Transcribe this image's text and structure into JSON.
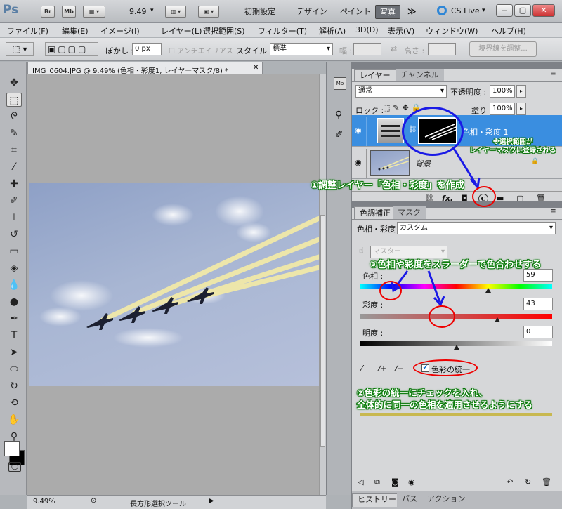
{
  "app": {
    "logo": "Ps",
    "bridge": "Br",
    "minibridge": "Mb",
    "zoom": "9.49",
    "workspaces": [
      "初期設定",
      "デザイン",
      "ペイント",
      "写真"
    ],
    "more": "≫",
    "cslive": "CS Live"
  },
  "menu": [
    "ファイル(F)",
    "編集(E)",
    "イメージ(I)",
    "レイヤー(L)",
    "選択範囲(S)",
    "フィルター(T)",
    "解析(A)",
    "3D(D)",
    "表示(V)",
    "ウィンドウ(W)",
    "ヘルプ(H)"
  ],
  "options": {
    "feather_label": "ぼかし :",
    "feather_value": "0 px",
    "antialias": "アンチエイリアス",
    "style_label": "スタイル :",
    "style_value": "標準",
    "width_label": "幅 :",
    "height_label": "高さ :",
    "refine_edge": "境界線を調整..."
  },
  "document": {
    "tab_title": "IMG_0604.JPG @ 9.49% (色相・彩度1, レイヤーマスク/8) *",
    "status_zoom": "9.49%",
    "status_tool": "長方形選択ツール"
  },
  "layers_panel": {
    "tabs": [
      "レイヤー",
      "チャンネル"
    ],
    "blend_mode": "通常",
    "opacity_label": "不透明度 :",
    "opacity": "100%",
    "lock_label": "ロック :",
    "fill_label": "塗り :",
    "fill": "100%",
    "layers": [
      {
        "name": "色相・彩度 1"
      },
      {
        "name": "背景"
      }
    ]
  },
  "adjust_panel": {
    "tabs": [
      "色調補正",
      "マスク"
    ],
    "title": "色相・彩度",
    "preset": "カスタム",
    "master": "マスター",
    "hue_label": "色相 :",
    "hue_value": "59",
    "saturation_label": "彩度 :",
    "saturation_value": "43",
    "lightness_label": "明度 :",
    "lightness_value": "0",
    "colorize_label": "色彩の統一",
    "colorize_checked": true,
    "hue_level": 0.665,
    "saturation_level": 0.715,
    "lightness_level": 0.5
  },
  "bottom_tabs": [
    "ヒストリー",
    "パス",
    "アクション"
  ],
  "annotations": {
    "note_mask": "※選択範囲が\nレイヤーマスクに登録される",
    "step1": "①調整レイヤー「色相・彩度」を作成",
    "step3": "③色相や彩度をスラーダーで色合わせする",
    "step2_line1": "②色彩の統一にチェックを入れ、",
    "step2_line2": "全体的に同一の色相を適用させるようにする"
  },
  "colors": {
    "accent_blue": "#3a8ee0",
    "annotation_green": "#0a8a0a",
    "annotation_red": "#e00000",
    "colorize_swatch": "#c8b850"
  }
}
